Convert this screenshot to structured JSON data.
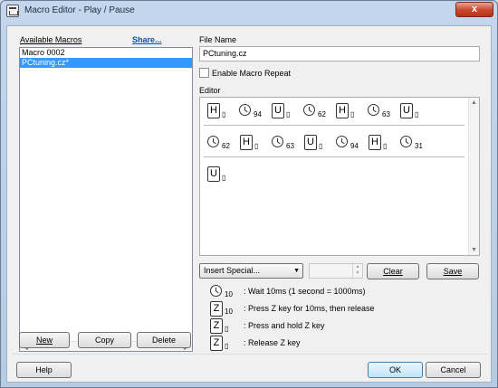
{
  "window": {
    "title": "Macro Editor - Play / Pause",
    "close_glyph": "x"
  },
  "left": {
    "available_label": "Available Macros",
    "share_label": "Share...",
    "macros": [
      "Macro 0002",
      "PCtuning.cz*"
    ],
    "selected_index": 1,
    "new_label": "New",
    "copy_label": "Copy",
    "delete_label": "Delete"
  },
  "right": {
    "file_name_label": "File Name",
    "file_name_value": "PCtuning.cz",
    "repeat_label": "Enable Macro Repeat",
    "repeat_checked": false,
    "editor_label": "Editor",
    "editor_rows": [
      [
        {
          "type": "press",
          "key": "H",
          "sub": "▯"
        },
        {
          "type": "wait",
          "sub": "94"
        },
        {
          "type": "press",
          "key": "U",
          "sub": "▯"
        },
        {
          "type": "wait",
          "sub": "62"
        },
        {
          "type": "press",
          "key": "H",
          "sub": "▯"
        },
        {
          "type": "wait",
          "sub": "63"
        },
        {
          "type": "press",
          "key": "U",
          "sub": "▯"
        }
      ],
      [
        {
          "type": "wait",
          "sub": "62"
        },
        {
          "type": "press",
          "key": "H",
          "sub": "▯"
        },
        {
          "type": "wait",
          "sub": "63"
        },
        {
          "type": "press",
          "key": "U",
          "sub": "▯"
        },
        {
          "type": "wait",
          "sub": "94"
        },
        {
          "type": "press",
          "key": "H",
          "sub": "▯"
        },
        {
          "type": "wait",
          "sub": "31"
        }
      ],
      [
        {
          "type": "press",
          "key": "U",
          "sub": "▯"
        }
      ]
    ],
    "insert_special_label": "Insert Special...",
    "clear_label": "Clear",
    "save_label": "Save"
  },
  "legend": [
    {
      "icon": "clock-icon",
      "sub": "10",
      "text": ": Wait 10ms (1 second = 1000ms)"
    },
    {
      "icon": "key-z-icon",
      "key": "Z",
      "sub": "10",
      "text": ": Press Z key for 10ms, then release"
    },
    {
      "icon": "key-z-icon",
      "key": "Z",
      "sub": "▯",
      "text": ": Press and hold Z key"
    },
    {
      "icon": "key-z-icon",
      "key": "Z",
      "sub": "▯",
      "text": ": Release Z key"
    }
  ],
  "footer": {
    "help_label": "Help",
    "ok_label": "OK",
    "cancel_label": "Cancel"
  },
  "colors": {
    "selection": "#3399ff",
    "link": "#0a4fb0",
    "close_button": "#c9452b",
    "frame": "#b6cbe4"
  }
}
